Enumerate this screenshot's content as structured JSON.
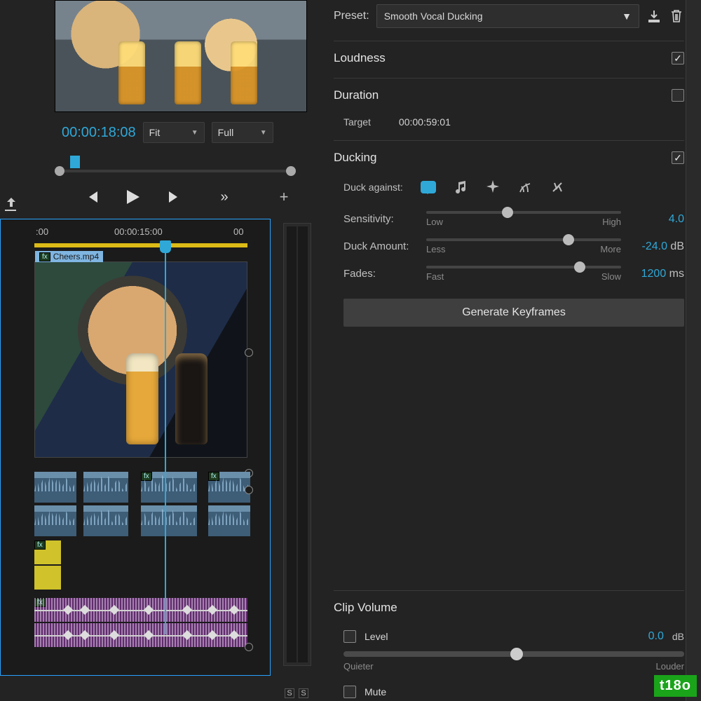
{
  "preview": {
    "timecode": "00:00:18:08",
    "zoom": "Fit",
    "quality": "Full"
  },
  "timeline": {
    "ruler": {
      "start": ":00",
      "mid": "00:00:15:00",
      "end": "00"
    },
    "clip_name": "Cheers.mp4",
    "fx_chip": "fx",
    "solo1": "S",
    "solo2": "S"
  },
  "preset": {
    "label": "Preset:",
    "value": "Smooth Vocal Ducking"
  },
  "loudness": {
    "title": "Loudness",
    "checked": true
  },
  "duration": {
    "title": "Duration",
    "checked": false,
    "target_label": "Target",
    "target_value": "00:00:59:01"
  },
  "ducking": {
    "title": "Ducking",
    "checked": true,
    "duck_against_label": "Duck against:",
    "sensitivity": {
      "label": "Sensitivity:",
      "min": "Low",
      "max": "High",
      "value": "4.0",
      "pos": 39
    },
    "amount": {
      "label": "Duck Amount:",
      "min": "Less",
      "max": "More",
      "value": "-24.0",
      "unit": " dB",
      "pos": 70
    },
    "fades": {
      "label": "Fades:",
      "min": "Fast",
      "max": "Slow",
      "value": "1200",
      "unit": " ms",
      "pos": 76
    },
    "generate": "Generate Keyframes"
  },
  "clip_volume": {
    "title": "Clip Volume",
    "level_label": "Level",
    "level_value": "0.0",
    "level_unit": " dB",
    "min": "Quieter",
    "max": "Louder",
    "mute_label": "Mute"
  },
  "brand": "t18o"
}
